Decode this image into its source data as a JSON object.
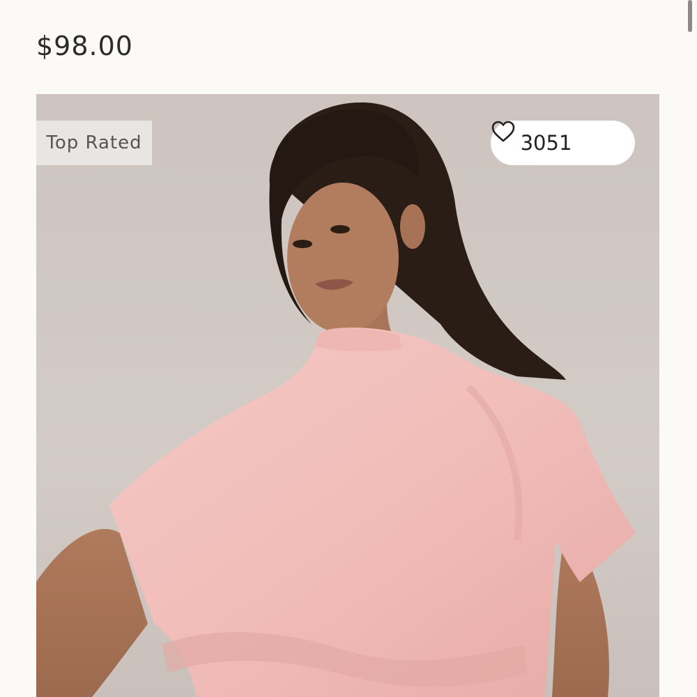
{
  "product": {
    "price": "$98.00",
    "badge": "Top Rated",
    "likes": "3051"
  },
  "icons": {
    "like": "heart-outline-icon"
  },
  "colors": {
    "background": "#fbfaf7",
    "price_text": "#2b2b2b",
    "badge_bg": "#ece9e6",
    "pill_bg": "#ffffff",
    "top_color": "#f2c0bd"
  }
}
